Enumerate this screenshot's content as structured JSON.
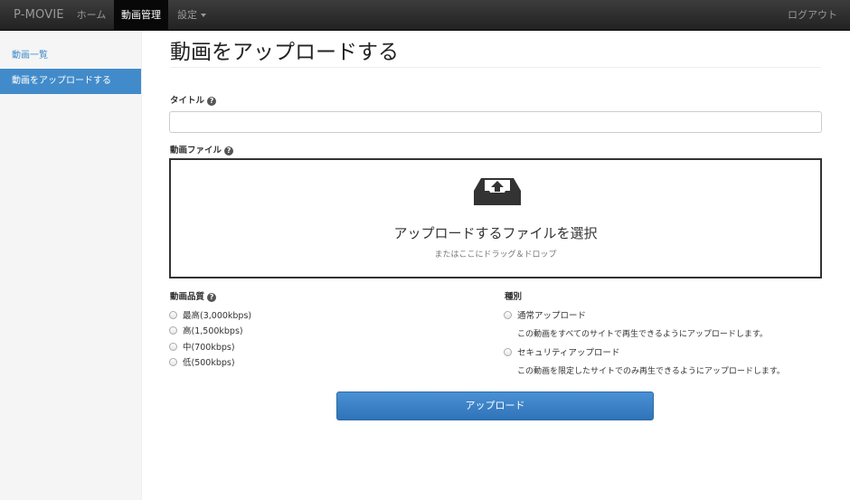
{
  "navbar": {
    "brand": "P-MOVIE",
    "home": "ホーム",
    "video_management": "動画管理",
    "settings": "設定",
    "logout": "ログアウト"
  },
  "sidebar": {
    "items": [
      {
        "label": "動画一覧"
      },
      {
        "label": "動画をアップロードする"
      }
    ]
  },
  "main": {
    "title": "動画をアップロードする",
    "title_field_label": "タイトル",
    "title_value": "",
    "file_label": "動画ファイル",
    "dropzone": {
      "main": "アップロードするファイルを選択",
      "sub": "またはここにドラッグ＆ドロップ"
    },
    "quality_label": "動画品質",
    "quality_options": [
      {
        "label": "最高(3,000kbps)"
      },
      {
        "label": "高(1,500kbps)"
      },
      {
        "label": "中(700kbps)"
      },
      {
        "label": "低(500kbps)"
      }
    ],
    "type_label": "種別",
    "type_options": [
      {
        "label": "通常アップロード",
        "desc": "この動画をすべてのサイトで再生できるようにアップロードします。"
      },
      {
        "label": "セキュリティアップロード",
        "desc": "この動画を限定したサイトでのみ再生できるようにアップロードします。"
      }
    ],
    "submit": "アップロード"
  },
  "colors": {
    "primary": "#428bca",
    "navbar": "#222222"
  },
  "icons": {
    "help": "question-circle-icon",
    "upload": "upload-tray-icon"
  }
}
